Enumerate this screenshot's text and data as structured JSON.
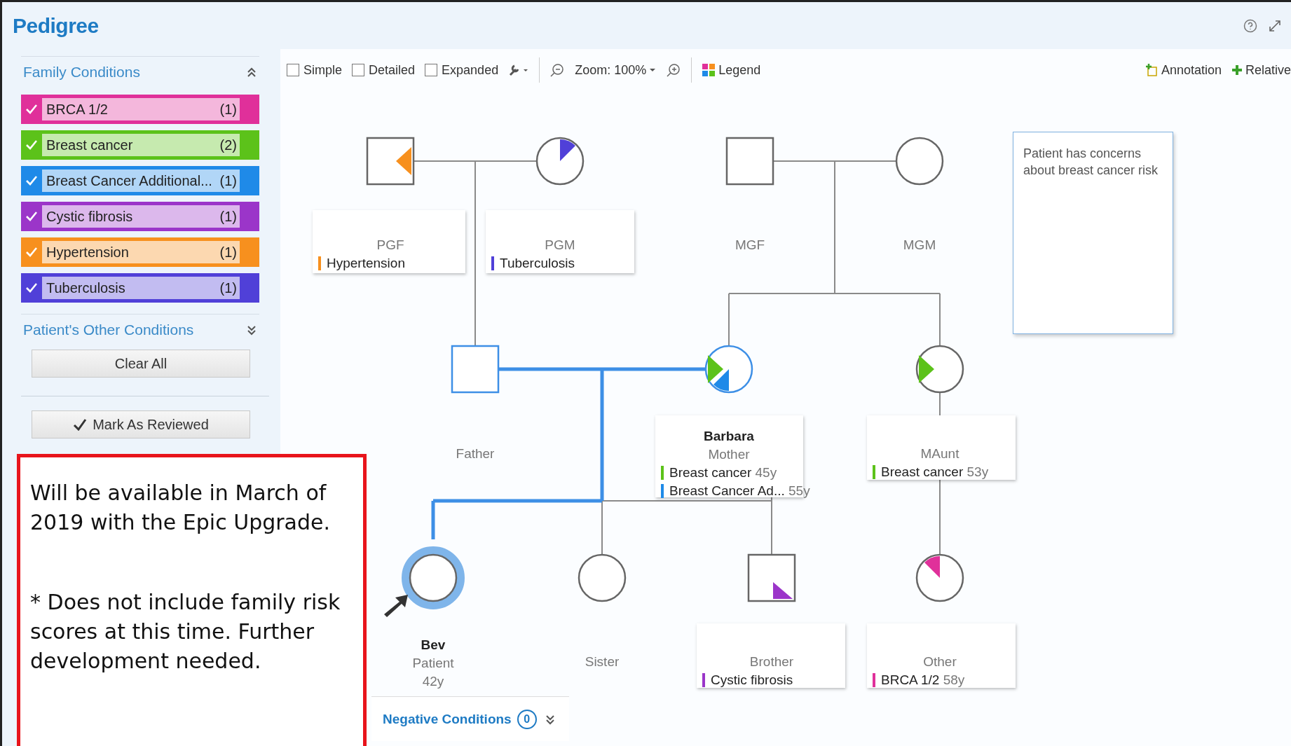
{
  "window": {
    "title": "Pedigree"
  },
  "family_conditions": {
    "title": "Family Conditions",
    "expanded": true,
    "items": [
      {
        "label": "BRCA 1/2",
        "count": "(1)",
        "checked": true,
        "color": "#e0309a"
      },
      {
        "label": "Breast cancer",
        "count": "(2)",
        "checked": true,
        "color": "#5cc21a"
      },
      {
        "label": "Breast Cancer Additional...",
        "count": "(1)",
        "checked": true,
        "color": "#1f8ae8"
      },
      {
        "label": "Cystic fibrosis",
        "count": "(1)",
        "checked": true,
        "color": "#9b35c9"
      },
      {
        "label": "Hypertension",
        "count": "(1)",
        "checked": true,
        "color": "#f7901e"
      },
      {
        "label": "Tuberculosis",
        "count": "(1)",
        "checked": true,
        "color": "#5040d8"
      }
    ]
  },
  "other_conditions": {
    "title": "Patient's Other Conditions",
    "expanded": false,
    "clear_button": "Clear All",
    "review_button": "Mark As Reviewed"
  },
  "note": {
    "lines": [
      "Will be available in March of 2019 with the Epic Upgrade.",
      "* Does not include family risk scores at this time. Further development needed."
    ]
  },
  "toolbar": {
    "views": [
      {
        "label": "Simple",
        "checked": false
      },
      {
        "label": "Detailed",
        "checked": false
      },
      {
        "label": "Expanded",
        "checked": false
      }
    ],
    "zoom": "Zoom: 100%",
    "legend": "Legend",
    "annotation": "Annotation",
    "relative": "Relative"
  },
  "annotation_box": {
    "text": "Patient has concerns about breast cancer risk"
  },
  "members": [
    {
      "kind": "male",
      "label": "PGF",
      "highlighted": false,
      "proband": false,
      "conditions": [
        {
          "name": "Hypertension",
          "color": "#f7901e"
        }
      ]
    },
    {
      "kind": "female",
      "label": "PGM",
      "highlighted": false,
      "proband": false,
      "conditions": [
        {
          "name": "Tuberculosis",
          "color": "#5040d8"
        }
      ]
    },
    {
      "kind": "male",
      "label": "MGF",
      "highlighted": false,
      "proband": false
    },
    {
      "kind": "female",
      "label": "MGM",
      "highlighted": false,
      "proband": false
    },
    {
      "kind": "male",
      "label": "Father",
      "highlighted": true,
      "proband": false
    },
    {
      "kind": "female",
      "name": "Barbara",
      "label": "Mother",
      "highlighted": true,
      "proband": false,
      "conditions": [
        {
          "name": "Breast cancer",
          "age": "45y",
          "color": "#5cc21a"
        },
        {
          "name": "Breast Cancer Ad...",
          "age": "55y",
          "color": "#1f8ae8"
        }
      ]
    },
    {
      "kind": "female",
      "label": "MAunt",
      "highlighted": false,
      "proband": false,
      "conditions": [
        {
          "name": "Breast cancer",
          "age": "53y",
          "color": "#5cc21a"
        }
      ]
    },
    {
      "kind": "female",
      "name": "Bev",
      "label": "Patient",
      "age": "42y",
      "highlighted": false,
      "proband": true
    },
    {
      "kind": "female",
      "label": "Sister",
      "highlighted": false,
      "proband": false
    },
    {
      "kind": "male",
      "label": "Brother",
      "highlighted": false,
      "proband": false,
      "conditions": [
        {
          "name": "Cystic fibrosis",
          "color": "#9b35c9"
        }
      ]
    },
    {
      "kind": "female",
      "label": "Other",
      "highlighted": false,
      "proband": false,
      "conditions": [
        {
          "name": "BRCA 1/2",
          "age": "58y",
          "color": "#e0309a"
        }
      ]
    }
  ],
  "negative_conditions": {
    "label": "Negative Conditions",
    "count": "0"
  }
}
